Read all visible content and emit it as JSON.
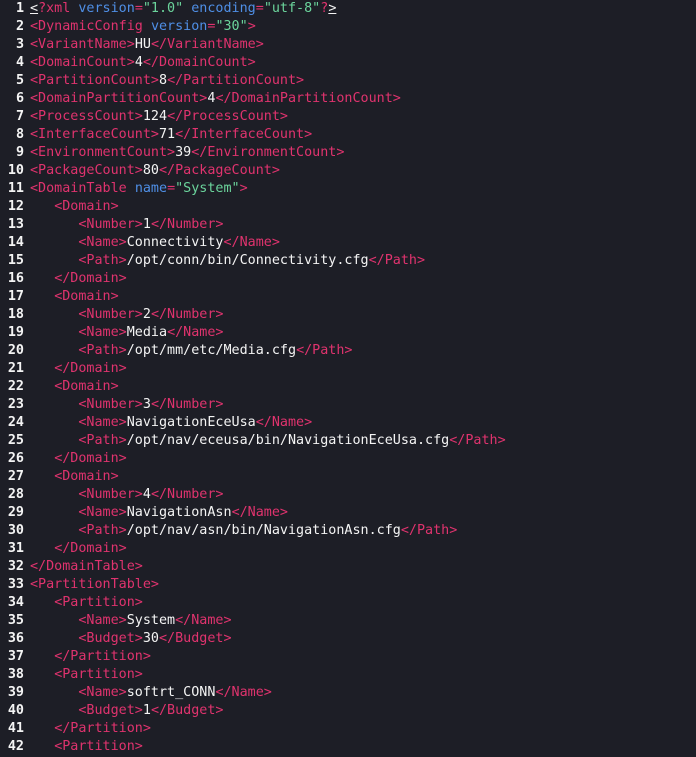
{
  "editor": {
    "colors": {
      "background": "#1d1e26",
      "tag": "#e0336e",
      "attribute": "#4f8fe6",
      "string": "#6bd49c",
      "text": "#f4f4f4"
    },
    "lines": [
      {
        "n": "1",
        "indent": "",
        "parts": [
          [
            "caret",
            "<"
          ],
          [
            "pi",
            "?xml "
          ],
          [
            "attr",
            "version"
          ],
          [
            "punct",
            "="
          ],
          [
            "str",
            "\"1.0\""
          ],
          [
            "text",
            " "
          ],
          [
            "attr",
            "encoding"
          ],
          [
            "punct",
            "="
          ],
          [
            "str",
            "\"utf-8\""
          ],
          [
            "pi",
            "?"
          ],
          [
            "caret",
            ">"
          ]
        ]
      },
      {
        "n": "2",
        "indent": "",
        "parts": [
          [
            "tag",
            "<DynamicConfig "
          ],
          [
            "attr",
            "version"
          ],
          [
            "punct",
            "="
          ],
          [
            "str",
            "\"30\""
          ],
          [
            "tag",
            ">"
          ]
        ]
      },
      {
        "n": "3",
        "indent": "",
        "parts": [
          [
            "tag",
            "<VariantName>"
          ],
          [
            "text",
            "HU"
          ],
          [
            "tag",
            "</VariantName>"
          ]
        ]
      },
      {
        "n": "4",
        "indent": "",
        "parts": [
          [
            "tag",
            "<DomainCount>"
          ],
          [
            "text",
            "4"
          ],
          [
            "tag",
            "</DomainCount>"
          ]
        ]
      },
      {
        "n": "5",
        "indent": "",
        "parts": [
          [
            "tag",
            "<PartitionCount>"
          ],
          [
            "text",
            "8"
          ],
          [
            "tag",
            "</PartitionCount>"
          ]
        ]
      },
      {
        "n": "6",
        "indent": "",
        "parts": [
          [
            "tag",
            "<DomainPartitionCount>"
          ],
          [
            "text",
            "4"
          ],
          [
            "tag",
            "</DomainPartitionCount>"
          ]
        ]
      },
      {
        "n": "7",
        "indent": "",
        "parts": [
          [
            "tag",
            "<ProcessCount>"
          ],
          [
            "text",
            "124"
          ],
          [
            "tag",
            "</ProcessCount>"
          ]
        ]
      },
      {
        "n": "8",
        "indent": "",
        "parts": [
          [
            "tag",
            "<InterfaceCount>"
          ],
          [
            "text",
            "71"
          ],
          [
            "tag",
            "</InterfaceCount>"
          ]
        ]
      },
      {
        "n": "9",
        "indent": "",
        "parts": [
          [
            "tag",
            "<EnvironmentCount>"
          ],
          [
            "text",
            "39"
          ],
          [
            "tag",
            "</EnvironmentCount>"
          ]
        ]
      },
      {
        "n": "10",
        "indent": "",
        "parts": [
          [
            "tag",
            "<PackageCount>"
          ],
          [
            "text",
            "80"
          ],
          [
            "tag",
            "</PackageCount>"
          ]
        ]
      },
      {
        "n": "11",
        "indent": "",
        "parts": [
          [
            "tag",
            "<DomainTable "
          ],
          [
            "attr",
            "name"
          ],
          [
            "punct",
            "="
          ],
          [
            "str",
            "\"System\""
          ],
          [
            "tag",
            ">"
          ]
        ]
      },
      {
        "n": "12",
        "indent": "   ",
        "parts": [
          [
            "tag",
            "<Domain>"
          ]
        ]
      },
      {
        "n": "13",
        "indent": "      ",
        "parts": [
          [
            "tag",
            "<Number>"
          ],
          [
            "text",
            "1"
          ],
          [
            "tag",
            "</Number>"
          ]
        ]
      },
      {
        "n": "14",
        "indent": "      ",
        "parts": [
          [
            "tag",
            "<Name>"
          ],
          [
            "text",
            "Connectivity"
          ],
          [
            "tag",
            "</Name>"
          ]
        ]
      },
      {
        "n": "15",
        "indent": "      ",
        "parts": [
          [
            "tag",
            "<Path>"
          ],
          [
            "text",
            "/opt/conn/bin/Connectivity.cfg"
          ],
          [
            "tag",
            "</Path>"
          ]
        ]
      },
      {
        "n": "16",
        "indent": "   ",
        "parts": [
          [
            "tag",
            "</Domain>"
          ]
        ]
      },
      {
        "n": "17",
        "indent": "   ",
        "parts": [
          [
            "tag",
            "<Domain>"
          ]
        ]
      },
      {
        "n": "18",
        "indent": "      ",
        "parts": [
          [
            "tag",
            "<Number>"
          ],
          [
            "text",
            "2"
          ],
          [
            "tag",
            "</Number>"
          ]
        ]
      },
      {
        "n": "19",
        "indent": "      ",
        "parts": [
          [
            "tag",
            "<Name>"
          ],
          [
            "text",
            "Media"
          ],
          [
            "tag",
            "</Name>"
          ]
        ]
      },
      {
        "n": "20",
        "indent": "      ",
        "parts": [
          [
            "tag",
            "<Path>"
          ],
          [
            "text",
            "/opt/mm/etc/Media.cfg"
          ],
          [
            "tag",
            "</Path>"
          ]
        ]
      },
      {
        "n": "21",
        "indent": "   ",
        "parts": [
          [
            "tag",
            "</Domain>"
          ]
        ]
      },
      {
        "n": "22",
        "indent": "   ",
        "parts": [
          [
            "tag",
            "<Domain>"
          ]
        ]
      },
      {
        "n": "23",
        "indent": "      ",
        "parts": [
          [
            "tag",
            "<Number>"
          ],
          [
            "text",
            "3"
          ],
          [
            "tag",
            "</Number>"
          ]
        ]
      },
      {
        "n": "24",
        "indent": "      ",
        "parts": [
          [
            "tag",
            "<Name>"
          ],
          [
            "text",
            "NavigationEceUsa"
          ],
          [
            "tag",
            "</Name>"
          ]
        ]
      },
      {
        "n": "25",
        "indent": "      ",
        "parts": [
          [
            "tag",
            "<Path>"
          ],
          [
            "text",
            "/opt/nav/eceusa/bin/NavigationEceUsa.cfg"
          ],
          [
            "tag",
            "</Path>"
          ]
        ]
      },
      {
        "n": "26",
        "indent": "   ",
        "parts": [
          [
            "tag",
            "</Domain>"
          ]
        ]
      },
      {
        "n": "27",
        "indent": "   ",
        "parts": [
          [
            "tag",
            "<Domain>"
          ]
        ]
      },
      {
        "n": "28",
        "indent": "      ",
        "parts": [
          [
            "tag",
            "<Number>"
          ],
          [
            "text",
            "4"
          ],
          [
            "tag",
            "</Number>"
          ]
        ]
      },
      {
        "n": "29",
        "indent": "      ",
        "parts": [
          [
            "tag",
            "<Name>"
          ],
          [
            "text",
            "NavigationAsn"
          ],
          [
            "tag",
            "</Name>"
          ]
        ]
      },
      {
        "n": "30",
        "indent": "      ",
        "parts": [
          [
            "tag",
            "<Path>"
          ],
          [
            "text",
            "/opt/nav/asn/bin/NavigationAsn.cfg"
          ],
          [
            "tag",
            "</Path>"
          ]
        ]
      },
      {
        "n": "31",
        "indent": "   ",
        "parts": [
          [
            "tag",
            "</Domain>"
          ]
        ]
      },
      {
        "n": "32",
        "indent": "",
        "parts": [
          [
            "tag",
            "</DomainTable>"
          ]
        ]
      },
      {
        "n": "33",
        "indent": "",
        "parts": [
          [
            "tag",
            "<PartitionTable>"
          ]
        ]
      },
      {
        "n": "34",
        "indent": "   ",
        "parts": [
          [
            "tag",
            "<Partition>"
          ]
        ]
      },
      {
        "n": "35",
        "indent": "      ",
        "parts": [
          [
            "tag",
            "<Name>"
          ],
          [
            "text",
            "System"
          ],
          [
            "tag",
            "</Name>"
          ]
        ]
      },
      {
        "n": "36",
        "indent": "      ",
        "parts": [
          [
            "tag",
            "<Budget>"
          ],
          [
            "text",
            "30"
          ],
          [
            "tag",
            "</Budget>"
          ]
        ]
      },
      {
        "n": "37",
        "indent": "   ",
        "parts": [
          [
            "tag",
            "</Partition>"
          ]
        ]
      },
      {
        "n": "38",
        "indent": "   ",
        "parts": [
          [
            "tag",
            "<Partition>"
          ]
        ]
      },
      {
        "n": "39",
        "indent": "      ",
        "parts": [
          [
            "tag",
            "<Name>"
          ],
          [
            "text",
            "softrt_CONN"
          ],
          [
            "tag",
            "</Name>"
          ]
        ]
      },
      {
        "n": "40",
        "indent": "      ",
        "parts": [
          [
            "tag",
            "<Budget>"
          ],
          [
            "text",
            "1"
          ],
          [
            "tag",
            "</Budget>"
          ]
        ]
      },
      {
        "n": "41",
        "indent": "   ",
        "parts": [
          [
            "tag",
            "</Partition>"
          ]
        ]
      },
      {
        "n": "42",
        "indent": "   ",
        "parts": [
          [
            "tag",
            "<Partition>"
          ]
        ]
      }
    ]
  }
}
